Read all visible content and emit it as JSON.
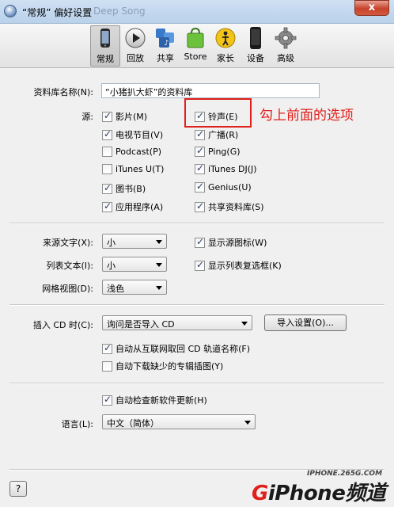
{
  "window": {
    "title": "“常规” 偏好设置",
    "background_title": "Deep Song",
    "close_label": "x"
  },
  "toolbar": {
    "items": [
      {
        "label": "常规",
        "icon": "iphone-icon",
        "active": true
      },
      {
        "label": "回放",
        "icon": "play-icon"
      },
      {
        "label": "共享",
        "icon": "share-icon"
      },
      {
        "label": "Store",
        "icon": "store-bag-icon"
      },
      {
        "label": "家长",
        "icon": "parental-icon"
      },
      {
        "label": "设备",
        "icon": "device-icon"
      },
      {
        "label": "高级",
        "icon": "gear-icon"
      }
    ]
  },
  "library": {
    "label": "资料库名称(N):",
    "value": "“小猪扒大虾”的资料库"
  },
  "sources": {
    "label": "源:",
    "left": [
      {
        "label": "影片(M)",
        "checked": true
      },
      {
        "label": "电视节目(V)",
        "checked": true
      },
      {
        "label": "Podcast(P)",
        "checked": false
      },
      {
        "label": "iTunes U(T)",
        "checked": false
      },
      {
        "label": "图书(B)",
        "checked": true
      },
      {
        "label": "应用程序(A)",
        "checked": true
      }
    ],
    "right": [
      {
        "label": "铃声(E)",
        "checked": true
      },
      {
        "label": "广播(R)",
        "checked": true
      },
      {
        "label": "Ping(G)",
        "checked": true
      },
      {
        "label": "iTunes DJ(J)",
        "checked": true
      },
      {
        "label": "Genius(U)",
        "checked": true
      },
      {
        "label": "共享资料库(S)",
        "checked": true
      }
    ]
  },
  "annotation": {
    "text": "勾上前面的选项",
    "color": "#e0201b"
  },
  "view": {
    "source_text_label": "来源文字(X):",
    "source_text_value": "小",
    "list_text_label": "列表文本(I):",
    "list_text_value": "小",
    "grid_label": "网格视图(D):",
    "grid_value": "浅色",
    "show_source_icons": {
      "label": "显示源图标(W)",
      "checked": true
    },
    "show_list_checkboxes": {
      "label": "显示列表复选框(K)",
      "checked": true
    }
  },
  "cd": {
    "label": "插入 CD 时(C):",
    "value": "询问是否导入 CD",
    "import_button": "导入设置(O)...",
    "auto_names": {
      "label": "自动从互联网取回 CD 轨道名称(F)",
      "checked": true
    },
    "auto_artwork": {
      "label": "自动下载缺少的专辑插图(Y)",
      "checked": false
    }
  },
  "updates": {
    "check": {
      "label": "自动检查新软件更新(H)",
      "checked": true
    }
  },
  "language": {
    "label": "语言(L):",
    "value": "中文（简体）"
  },
  "help_label": "?",
  "watermark": {
    "url": "IPHONE.265G.COM",
    "logo_g": "G",
    "logo_rest": "iPhone频道"
  }
}
